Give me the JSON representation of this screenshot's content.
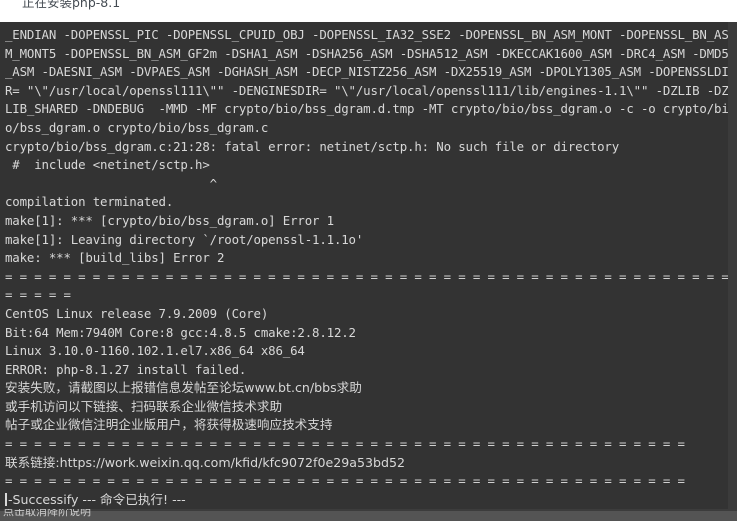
{
  "window": {
    "header_title": "正在安装php-8.1",
    "background_color": "#ffffff",
    "terminal_bg_color": "#333333",
    "terminal_fg_color": "#d8d8d8",
    "statusbar_bg_color": "#545454"
  },
  "terminal": {
    "lines": [
      {
        "text": "_ENDIAN -DOPENSSL_PIC -DOPENSSL_CPUID_OBJ -DOPENSSL_IA32_SSE2 -DOPENSSL_BN_ASM_MONT -DOPENSSL_BN_AS",
        "kind": "mono"
      },
      {
        "text": "M_MONT5 -DOPENSSL_BN_ASM_GF2m -DSHA1_ASM -DSHA256_ASM -DSHA512_ASM -DKECCAK1600_ASM -DRC4_ASM -DMD5",
        "kind": "mono"
      },
      {
        "text": "_ASM -DAESNI_ASM -DVPAES_ASM -DGHASH_ASM -DECP_NISTZ256_ASM -DX25519_ASM -DPOLY1305_ASM -DOPENSSLDI",
        "kind": "mono"
      },
      {
        "text": "R= \"\\\"/usr/local/openssl111\\\"\" -DENGINESDIR= \"\\\"/usr/local/openssl111/lib/engines-1.1\\\"\" -DZLIB -DZ",
        "kind": "mono"
      },
      {
        "text": "LIB_SHARED -DNDEBUG  -MMD -MF crypto/bio/bss_dgram.d.tmp -MT crypto/bio/bss_dgram.o -c -o crypto/bi",
        "kind": "mono"
      },
      {
        "text": "o/bss_dgram.o crypto/bio/bss_dgram.c",
        "kind": "mono"
      },
      {
        "text": "crypto/bio/bss_dgram.c:21:28: fatal error: netinet/sctp.h: No such file or directory",
        "kind": "mono"
      },
      {
        "text": " #  include <netinet/sctp.h>",
        "kind": "mono"
      },
      {
        "text": "                            ^",
        "kind": "mono"
      },
      {
        "text": "compilation terminated.",
        "kind": "mono"
      },
      {
        "text": "make[1]: *** [crypto/bio/bss_dgram.o] Error 1",
        "kind": "mono"
      },
      {
        "text": "make[1]: Leaving directory `/root/openssl-1.1.1o'",
        "kind": "mono"
      },
      {
        "text": "make: *** [build_libs] Error 2",
        "kind": "mono"
      },
      {
        "text": "= = = = = = = = = = = = = = = = = = = = = = = = = = = = = = = = = = = = = = = = = = = = = = = = = =",
        "kind": "sep"
      },
      {
        "text": "= = = = =",
        "kind": "sep"
      },
      {
        "text": "CentOS Linux release 7.9.2009 (Core)",
        "kind": "mono"
      },
      {
        "text": "Bit:64 Mem:7940M Core:8 gcc:4.8.5 cmake:2.8.12.2",
        "kind": "mono"
      },
      {
        "text": "Linux 3.10.0-1160.102.1.el7.x86_64 x86_64",
        "kind": "mono"
      },
      {
        "text": "ERROR: php-8.1.27 install failed.",
        "kind": "mono"
      },
      {
        "text": "安装失败，请截图以上报错信息发帖至论坛www.bt.cn/bbs求助",
        "kind": "cjk"
      },
      {
        "text": "或手机访问以下链接、扫码联系企业微信技术求助",
        "kind": "cjk"
      },
      {
        "text": "帖子或企业微信注明企业版用户，将获得极速响应技术支持",
        "kind": "cjk"
      },
      {
        "text": "= = = = = = = = = = = = = = = = = = = = = = = = = = = = = = = = = = = = = = = = = = = = = = =",
        "kind": "sep"
      },
      {
        "text": "联系链接:https://work.weixin.qq.com/kfid/kfc9072f0e29a53bd52",
        "kind": "cjk"
      },
      {
        "text": "= = = = = = = = = = = = = = = = = = = = = = = = = = = = = = = = = = = = = = = = = = = = = = =",
        "kind": "sep"
      },
      {
        "text": "-Successify --- 命令已执行! ---",
        "kind": "cursor"
      }
    ]
  },
  "statusbar": {
    "label": "点击取消降阶说明"
  }
}
